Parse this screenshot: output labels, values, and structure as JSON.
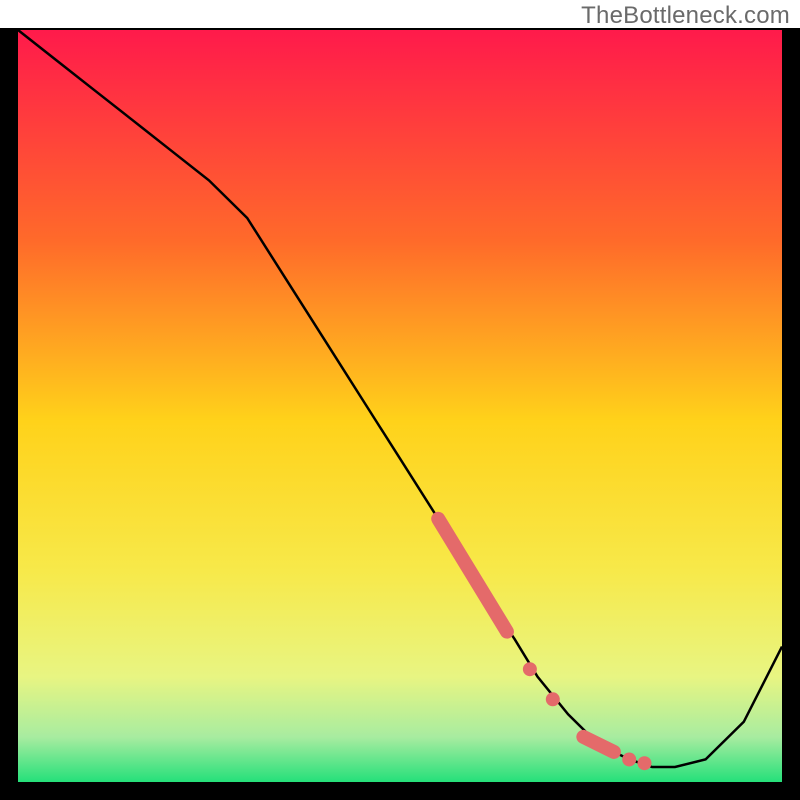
{
  "watermark": "TheBottleneck.com",
  "colors": {
    "frame": "#000000",
    "gradient_top": "#ff1a4b",
    "gradient_mid_upper": "#ff8a2a",
    "gradient_mid": "#ffd21a",
    "gradient_mid_lower": "#f7f56a",
    "gradient_near_bottom": "#d8f590",
    "gradient_bottom": "#25e07a",
    "curve": "#000000",
    "emphasis": "#e46a6a"
  },
  "chart_data": {
    "type": "line",
    "title": "",
    "xlabel": "",
    "ylabel": "",
    "xlim": [
      0,
      100
    ],
    "ylim": [
      0,
      100
    ],
    "series": [
      {
        "name": "bottleneck-curve",
        "x": [
          0,
          5,
          10,
          15,
          20,
          25,
          30,
          35,
          40,
          45,
          50,
          55,
          60,
          63,
          65,
          68,
          72,
          75,
          78,
          80,
          83,
          86,
          90,
          95,
          100
        ],
        "y": [
          100,
          96,
          92,
          88,
          84,
          80,
          75,
          67,
          59,
          51,
          43,
          35,
          27,
          22,
          19,
          14,
          9,
          6,
          4,
          3,
          2,
          2,
          3,
          8,
          18
        ]
      }
    ],
    "emphasis_segments": [
      {
        "type": "thick",
        "x": [
          55,
          64
        ],
        "y": [
          35,
          20
        ]
      },
      {
        "type": "dot",
        "x": 67,
        "y": 15
      },
      {
        "type": "dot",
        "x": 70,
        "y": 11
      },
      {
        "type": "thick",
        "x": [
          74,
          78
        ],
        "y": [
          6,
          4
        ]
      },
      {
        "type": "dot",
        "x": 80,
        "y": 3
      },
      {
        "type": "dot",
        "x": 82,
        "y": 2.5
      }
    ]
  }
}
